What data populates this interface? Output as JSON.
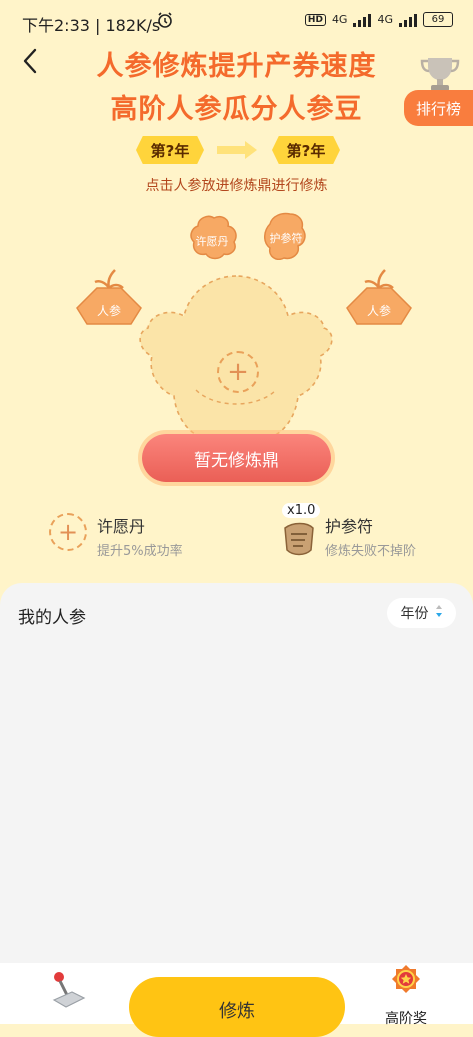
{
  "status_bar": {
    "time_speed": "下午2:33 | 182K/s",
    "hd_badge": "HD",
    "net_1": "4G",
    "net_2": "4G",
    "battery": "69"
  },
  "header": {
    "title_line1": "人参修炼提升产券速度",
    "title_line2": "高阶人参瓜分人参豆",
    "leaderboard_label": "排行榜"
  },
  "years": {
    "from_label": "第?年",
    "to_label": "第?年"
  },
  "instruction": "点击人参放进修炼鼎进行修炼",
  "cauldron": {
    "slot_wish_pill": "许愿丹",
    "slot_amulet": "护参符",
    "slot_left_ginseng": "人参",
    "slot_right_ginseng": "人参",
    "main_button": "暂无修炼鼎"
  },
  "items": [
    {
      "title": "许愿丹",
      "desc": "提升5%成功率"
    },
    {
      "title": "护参符",
      "desc": "修炼失败不掉阶",
      "count": "x1.0"
    }
  ],
  "panel": {
    "title": "我的人参",
    "sort_label": "年份"
  },
  "bottom": {
    "train_label": "修炼",
    "right_label": "高阶奖"
  },
  "colors": {
    "accent": "#f46a2c",
    "background": "#fff4c9",
    "primary_button": "#ffc413",
    "cauldron_button": "#ea5f56"
  }
}
